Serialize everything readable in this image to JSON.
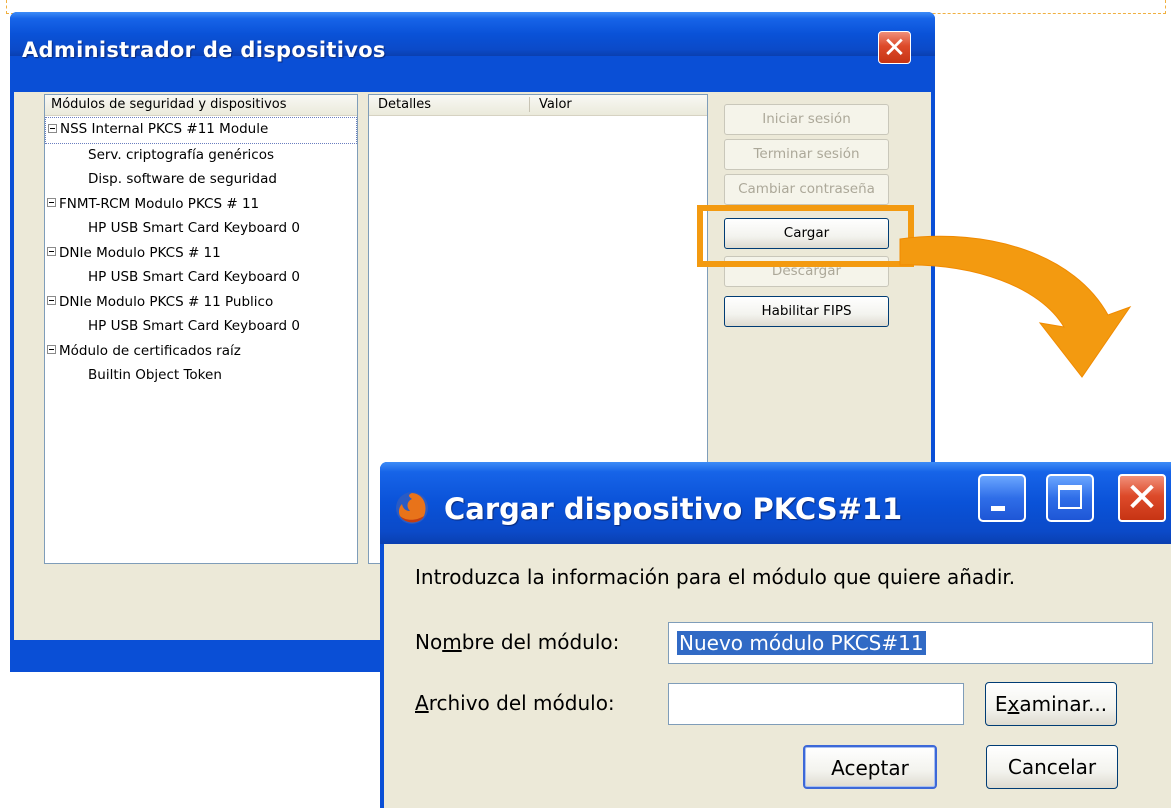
{
  "main_window": {
    "title": "Administrador de dispositivos",
    "modules_panel": {
      "header": "Módulos de seguridad y dispositivos",
      "items": [
        {
          "label": "NSS Internal PKCS #11 Module",
          "type": "module"
        },
        {
          "label": "Serv. criptografía genéricos",
          "type": "device"
        },
        {
          "label": "Disp. software de seguridad",
          "type": "device"
        },
        {
          "label": "FNMT-RCM Modulo PKCS # 11",
          "type": "module"
        },
        {
          "label": "HP USB Smart Card Keyboard 0",
          "type": "device"
        },
        {
          "label": "DNIe Modulo PKCS # 11",
          "type": "module"
        },
        {
          "label": "HP USB Smart Card Keyboard 0",
          "type": "device"
        },
        {
          "label": "DNIe Modulo PKCS # 11 Publico",
          "type": "module"
        },
        {
          "label": "HP USB Smart Card Keyboard 0",
          "type": "device"
        },
        {
          "label": "Módulo de certificados raíz",
          "type": "module"
        },
        {
          "label": "Builtin Object Token",
          "type": "device"
        }
      ]
    },
    "details_panel": {
      "col_details": "Detalles",
      "col_value": "Valor"
    },
    "buttons": {
      "login": "Iniciar sesión",
      "logout": "Terminar sesión",
      "change_password": "Cambiar contraseña",
      "load": "Cargar",
      "unload": "Descargar",
      "enable_fips": "Habilitar FIPS"
    },
    "highlight_color": "#f39a10"
  },
  "dialog": {
    "title": "Cargar dispositivo PKCS#11",
    "intro": "Introduzca la información para el módulo que quiere añadir.",
    "module_name_label": "Nombre del módulo:",
    "module_name_value": "Nuevo módulo PKCS#11",
    "module_file_label": "Archivo del módulo:",
    "module_file_value": "",
    "browse_button": "Examinar...",
    "ok_button": "Aceptar",
    "cancel_button": "Cancelar"
  }
}
